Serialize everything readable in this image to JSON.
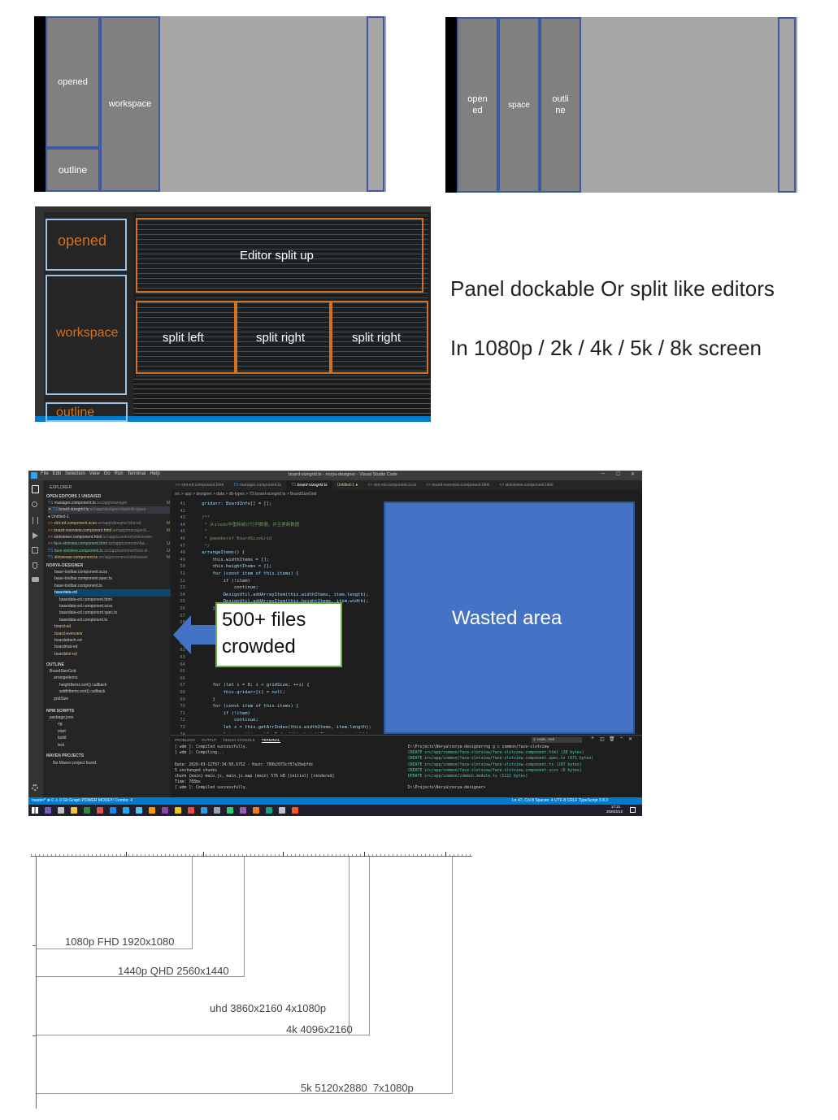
{
  "diagram1": {
    "opened": "opened",
    "workspace": "workspace",
    "outline": "outline"
  },
  "diagram2": {
    "opened": "open ed",
    "space": "space",
    "outline": "outli ne"
  },
  "screenshot1": {
    "labels": {
      "opened": "opened",
      "workspace": "workspace",
      "outline": "outline",
      "editor_split_up": "Editor split up",
      "split_left": "split left",
      "split_right_1": "split right",
      "split_right_2": "split right"
    }
  },
  "notes": {
    "line1": "Panel dockable Or split like editors",
    "line2": "In 1080p / 2k / 4k / 5k / 8k screen"
  },
  "vscode": {
    "title": "board-sizegrid.ts - norya-designer - Visual Studio Code",
    "menu": [
      "File",
      "Edit",
      "Selection",
      "View",
      "Go",
      "Run",
      "Terminal",
      "Help"
    ],
    "explorer_title": "EXPLORER",
    "open_editors": "OPEN EDITORS  1 UNSAVED",
    "open_files": [
      {
        "name": "manager.component.ts",
        "path": "src\\app\\manager",
        "flag": "M"
      },
      {
        "name": "board-sizegrid.ts",
        "path": "src\\app\\designer\\data\\db-types",
        "flag": ""
      },
      {
        "name": "Untitled-1",
        "path": "",
        "flag": ""
      },
      {
        "name": "slot-ed.component.scss",
        "path": "src\\app\\designer\\slot-ed",
        "flag": "M"
      },
      {
        "name": "board-overview.component.html",
        "path": "src\\app\\manager\\b...",
        "flag": "M"
      },
      {
        "name": "slotviewer.component.html",
        "path": "src\\app\\common\\slotviewer",
        "flag": ""
      },
      {
        "name": "face-slotview.component.html",
        "path": "src\\app\\common\\fac...",
        "flag": "U"
      },
      {
        "name": "face-slotview.component.ts",
        "path": "src\\app\\common\\face-sl...",
        "flag": "U"
      },
      {
        "name": "slotviewer.component.ts",
        "path": "src\\app\\common\\slotviewer",
        "flag": "M"
      }
    ],
    "project": "NORYA-DESIGNER",
    "tree": [
      "base-toolbar.component.scss",
      "base-toolbar.component.spec.ts",
      "base-toolbar.component.ts",
      "basedata-ed",
      "basedata-ed.component.html",
      "basedata-ed.component.scss",
      "basedata-ed.component.spec.ts",
      "basedata-ed.component.ts",
      "board-ed",
      "board-overview",
      "boardattach-ed",
      "boardmat-ed",
      "boardslot-ed"
    ],
    "outline_title": "OUTLINE",
    "outline_items": [
      "BoardSizeGrid",
      "arrangeItems",
      "heightItems.sort() callback",
      "widthItems.sort() callback",
      "gridSize"
    ],
    "npm_title": "NPM SCRIPTS",
    "npm_items": [
      "package.json",
      "ng",
      "start",
      "build",
      "test"
    ],
    "maven_title": "MAVEN PROJECTS",
    "maven_empty": "No Maven project found.",
    "tabs": [
      "slot-ed.component.html",
      "manager.component.ts",
      "board-sizegrid.ts",
      "Untitled-1",
      "slot-ed.component.scss",
      "board-overview.component.html",
      "slotviewer.component.html"
    ],
    "breadcrumb": "src > app > designer > data > db-types > TS board-sizegrid.ts > BoardSizeGrid",
    "code_lines": [
      "    gridarr: BoardInfo[] = [];",
      "",
      "    /**",
      "     * 从items中重新统计行列数据，并且更新数据",
      "     *",
      "     * @memberof BoardSizeGrid",
      "     */",
      "    arrangeItems() {",
      "        this.widthItems = [];",
      "        this.heightItems = [];",
      "        for (const item of this.items) {",
      "            if (!item)",
      "                continue;",
      "            DesignUtil.addArrayItem(this.widthItems, item.length);",
      "            DesignUtil.addArrayItem(this.heightItems, item.width);",
      "        }",
      "",
      "",
      "",
      "",
      "",
      "",
      "",
      "",
      "",
      "",
      "        for (let i = 0; i < gridSize; ++i) {",
      "            this.gridarr[i] = null;",
      "        }",
      "        for (const item of this.items) {",
      "            if (!item)",
      "                continue;",
      "            let x = this.getArrIndex(this.widthItems, item.length);",
      "            let y = this.getArrIndex(this.heightItems, item.width);",
      "            let index = y * this.widthCount + x;",
      "            this.gridarr[index] = item;",
      "        }"
    ],
    "line_start": 41,
    "panel_tabs": [
      "PROBLEMS",
      "OUTPUT",
      "DEBUG CONSOLE",
      "TERMINAL"
    ],
    "terminal_select": "1: node, cmd",
    "terminal_left": [
      "[ wdm ]: Compiled successfully.",
      "[ wdm ]: Compiling...",
      "",
      "Date: 2020-03-12T07:34:50.675Z - Hash: 709b2073cf57a39ebfdc",
      "5 unchanged chunks",
      "chunk {main} main.js, main.js.map (main) 576 kB [initial] [rendered]",
      "Time: 768ms",
      "[ wdm ]: Compiled successfully."
    ],
    "terminal_right": [
      "D:\\Projects\\Norya\\norya-designer>ng g c common/face-slotview",
      "CREATE src/app/common/face-slotview/face-slotview.component.html (28 bytes)",
      "CREATE src/app/common/face-slotview/face-slotview.component.spec.ts (671 bytes)",
      "CREATE src/app/common/face-slotview/face-slotview.component.ts (297 bytes)",
      "CREATE src/app/common/face-slotview/face-slotview.component.scss (0 bytes)",
      "UPDATE src/app/common/common.module.ts (1122 bytes)",
      "",
      "D:\\Projects\\Norya\\norya-designer>"
    ],
    "status_left": "master*  ⊗ 0 ⚠ 0   Git Graph   POWER MODE!!! Combo: 4",
    "status_right": "Ln 47, Col 8   Spaces: 4   UTF-8   CRLF   TypeScript   3.8.3",
    "taskbar_time": "17:21",
    "taskbar_date": "2020/3/12",
    "callout": "500+ files crowded",
    "callout_line1": "500+ files",
    "callout_line2": "crowded",
    "wasted": "Wasted area"
  },
  "resolutions": [
    "1080p FHD 1920x1080",
    "1440p QHD 2560x1440",
    "uhd 3860x2160 4x1080p",
    "4k 4096x2160",
    "5k 5120x2880  7x1080p"
  ],
  "colors": {
    "gray_dark": "#808080",
    "gray_light": "#a6a6a6",
    "box_border": "#3b5aa0",
    "orange": "#d4701e",
    "blue_area": "#4472c4",
    "vscode_bg": "#1e1e1e",
    "statusbar": "#007acc"
  }
}
